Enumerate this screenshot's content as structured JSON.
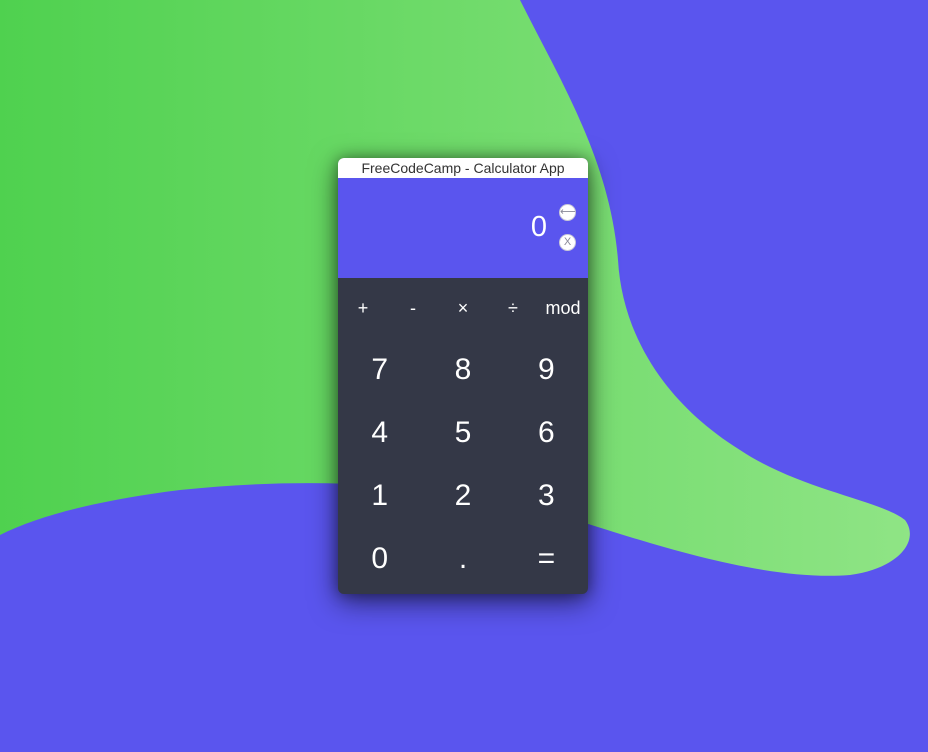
{
  "window": {
    "title": "FreeCodeCamp - Calculator App"
  },
  "display": {
    "value": "0",
    "backspace_symbol": "⟵",
    "clear_symbol": "X"
  },
  "operators": [
    "+",
    "-",
    "×",
    "÷",
    "mod"
  ],
  "keypad": [
    "7",
    "8",
    "9",
    "4",
    "5",
    "6",
    "1",
    "2",
    "3",
    "0",
    ".",
    "="
  ],
  "colors": {
    "accent": "#5a55ee",
    "keypad_bg": "#343847",
    "green_light": "#8de47f",
    "green_dark": "#4fd14f"
  }
}
